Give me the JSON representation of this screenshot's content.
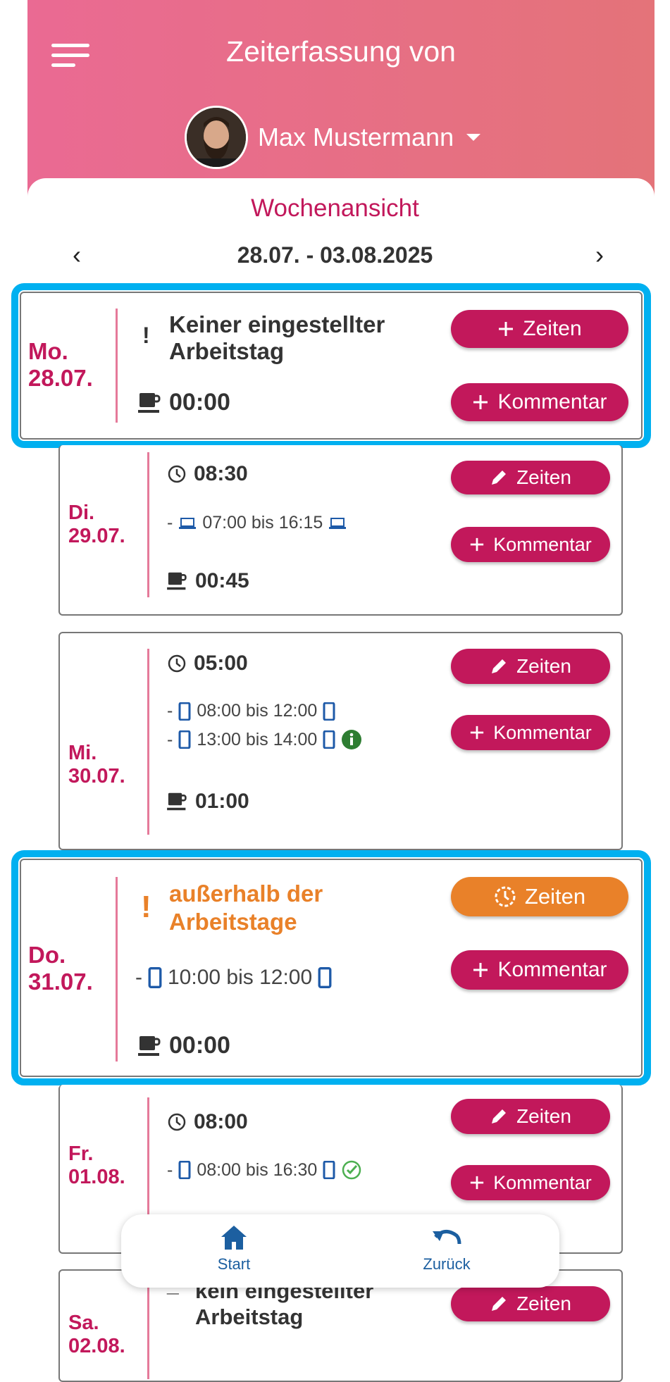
{
  "header": {
    "title": "Zeiterfassung von",
    "user_name": "Max Mustermann"
  },
  "view": {
    "title": "Wochenansicht",
    "week_range": "28.07. - 03.08.2025",
    "prev": "‹",
    "next": "›"
  },
  "days": [
    {
      "weekday": "Mo.",
      "date": "28.07.",
      "status_mark": "!",
      "status_line1": "Keiner eingestellter",
      "status_line2": "Arbeitstag",
      "break": "00:00",
      "btn_times": "Zeiten",
      "btn_comment": "Kommentar"
    },
    {
      "weekday": "Di.",
      "date": "29.07.",
      "total": "08:30",
      "entries": [
        {
          "prefix": "-",
          "text": "07:00 bis 16:15"
        }
      ],
      "break": "00:45",
      "btn_times": "Zeiten",
      "btn_comment": "Kommentar"
    },
    {
      "weekday": "Mi.",
      "date": "30.07.",
      "total": "05:00",
      "entries": [
        {
          "prefix": "-",
          "text": "08:00 bis 12:00"
        },
        {
          "prefix": "-",
          "text": "13:00 bis 14:00"
        }
      ],
      "break": "01:00",
      "btn_times": "Zeiten",
      "btn_comment": "Kommentar"
    },
    {
      "weekday": "Do.",
      "date": "31.07.",
      "status_mark": "!",
      "status_line1": "außerhalb der",
      "status_line2": "Arbeitstage",
      "entries": [
        {
          "prefix": "-",
          "text": "10:00 bis 12:00"
        }
      ],
      "break": "00:00",
      "btn_times": "Zeiten",
      "btn_comment": "Kommentar"
    },
    {
      "weekday": "Fr.",
      "date": "01.08.",
      "total": "08:00",
      "entries": [
        {
          "prefix": "-",
          "text": "08:00 bis 16:30"
        }
      ],
      "btn_times": "Zeiten",
      "btn_comment": "Kommentar"
    },
    {
      "weekday": "Sa.",
      "date": "02.08.",
      "status_mark": "_",
      "status_line1": "kein eingestellter",
      "status_line2": "Arbeitstag",
      "btn_times": "Zeiten"
    }
  ],
  "bottom_nav": {
    "start": "Start",
    "back": "Zurück"
  },
  "colors": {
    "accent": "#c2185b",
    "warning": "#e98129",
    "header_start": "#ea6a93",
    "header_end": "#e47379",
    "highlight": "#00b0f0",
    "nav": "#1c5fa0"
  },
  "icons": [
    "menu-icon",
    "avatar",
    "chevron-down-icon",
    "clock-icon",
    "laptop-icon",
    "phone-icon",
    "info-icon",
    "check-circle-icon",
    "coffee-icon",
    "pencil-icon",
    "plus-icon",
    "clock-dashed-icon",
    "home-icon",
    "undo-icon"
  ]
}
